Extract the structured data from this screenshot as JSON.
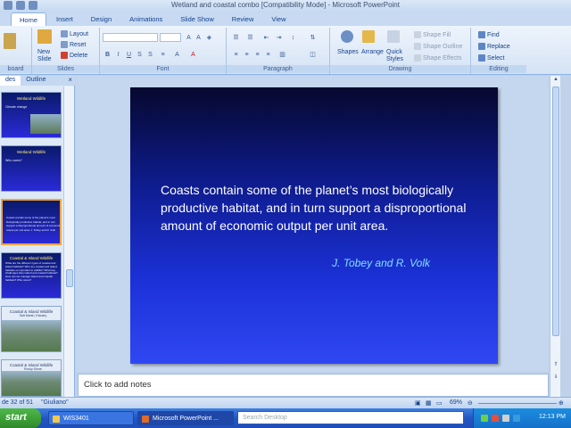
{
  "window": {
    "title": "Wetland and coastal combo [Compatibility Mode] - Microsoft PowerPoint"
  },
  "ribbon_tabs": [
    "Home",
    "Insert",
    "Design",
    "Animations",
    "Slide Show",
    "Review",
    "View"
  ],
  "clipboard": {
    "label": "board"
  },
  "slides_group": {
    "label": "Slides",
    "new_slide": "New",
    "new_slide2": "Slide",
    "layout": "Layout",
    "reset": "Reset",
    "delete": "Delete"
  },
  "font_group": {
    "label": "Font"
  },
  "paragraph_group": {
    "label": "Paragraph"
  },
  "drawing_group": {
    "label": "Drawing",
    "shapes": "Shapes",
    "arrange": "Arrange",
    "quick": "Quick",
    "styles": "Styles",
    "shape_fill": "Shape Fill",
    "shape_outline": "Shape Outline",
    "shape_effects": "Shape Effects"
  },
  "editing_group": {
    "label": "Editing",
    "find": "Find",
    "replace": "Replace",
    "select": "Select"
  },
  "panel": {
    "tab_slides": "des",
    "tab_outline": "Outline",
    "thumbs": [
      {
        "title": "Wetland Wildlife",
        "body": "Climate change"
      },
      {
        "title": "Wetland Wildlife",
        "body": "Who cares?"
      },
      {
        "title": "",
        "body": "Coasts contain some of the planet's most biologically productive habitat, and in turn support a disproportional amount of economic output per unit area. J. Tobey and R. Volk"
      },
      {
        "title": "Coastal & Island Wildlife",
        "body": "What are the different types of coastal and island habitats? Who are coastal and island habitats so important to wildlife? What key challenges face island and coastal habitats? How can we manage island and coastal habitats? Who cares?"
      },
      {
        "title": "Coastal & Island Wildlife",
        "body": "Salt Marsh, Estuary"
      },
      {
        "title": "Coastal & Island Wildlife",
        "body": "Rocky Shore"
      }
    ]
  },
  "slide": {
    "quote": "Coasts contain some of the planet’s most biologically productive habitat, and in turn support a disproportional amount of economic output per unit area.",
    "author": "J. Tobey and R. Volk"
  },
  "notes": {
    "placeholder": "Click to add notes"
  },
  "status": {
    "slide_info": "de 32 of 51",
    "theme": "\"Giuliano\"",
    "zoom": "69%"
  },
  "taskbar": {
    "start": "start",
    "tasks": [
      "WIS3401",
      "Microsoft PowerPoint ..."
    ],
    "search_placeholder": "Search Desktop",
    "clock": "12:13 PM"
  },
  "colors": {
    "slide_top": "#06082e",
    "slide_bottom": "#2f47f2",
    "author_text": "#7fe0ff",
    "taskbar": "#2355c4"
  }
}
